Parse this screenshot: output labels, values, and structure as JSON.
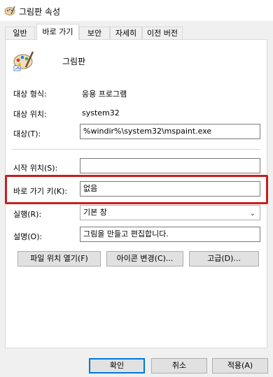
{
  "window": {
    "title": "그림판 속성"
  },
  "tabs": [
    {
      "label": "일반"
    },
    {
      "label": "바로 가기"
    },
    {
      "label": "보안"
    },
    {
      "label": "자세히"
    },
    {
      "label": "이전 버전"
    }
  ],
  "app": {
    "name": "그림판"
  },
  "info": {
    "type_label": "대상 형식:",
    "type_value": "응용 프로그램",
    "location_label": "대상 위치:",
    "location_value": "system32"
  },
  "fields": {
    "target_label": "대상(T):",
    "target_value": "%windir%\\system32\\mspaint.exe",
    "start_label": "시작 위치(S):",
    "start_value": "",
    "shortcut_label": "바로 가기 키(K):",
    "shortcut_value": "없음",
    "run_label": "실행(R):",
    "run_value": "기본 창",
    "comment_label": "설명(O):",
    "comment_value": "그림을 만들고 편집합니다."
  },
  "actions": {
    "open_location": "파일 위치 열기(F)",
    "change_icon": "아이콘 변경(C)...",
    "advanced": "고급(D)..."
  },
  "footer": {
    "ok": "확인",
    "cancel": "취소",
    "apply": "적용(A)"
  },
  "colors": {
    "highlight": "#c81e1e",
    "default_button_border": "#0078d7"
  },
  "icons": {
    "title": "paint-palette-icon",
    "app": "paint-palette-icon",
    "dropdown": "chevron-down-icon"
  }
}
